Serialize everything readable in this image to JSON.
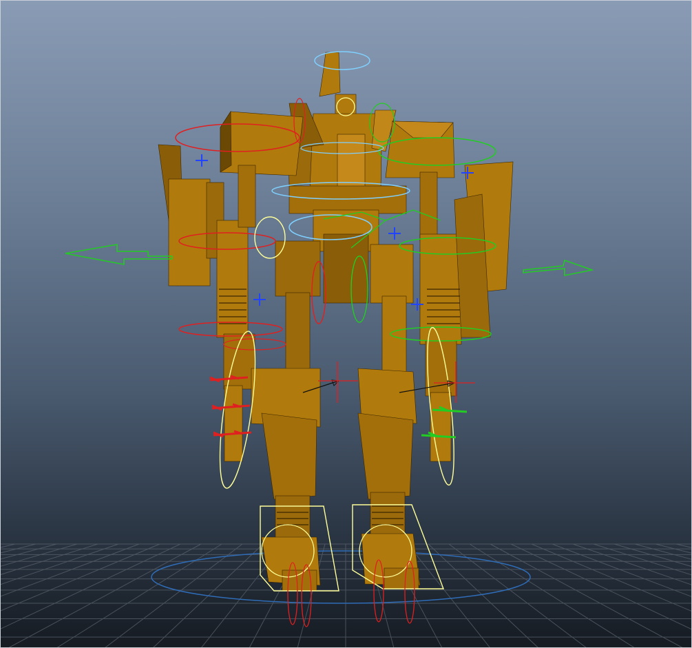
{
  "viewport": {
    "background_top": "#8a9cb5",
    "background_bottom": "#161b22",
    "grid_color": "#5d6670"
  },
  "model": {
    "name_icon": "robot-mesh-icon",
    "body_color": "#b07a0c",
    "shadow_color": "#5e3f05",
    "highlight_color": "#d19a1e"
  },
  "controls": {
    "red": "#e02020",
    "green": "#22cc22",
    "cyan": "#7fd0ff",
    "yellow": "#ffff99",
    "blue_cross": "#2244ff",
    "ground_ring": "#2f6db8"
  }
}
